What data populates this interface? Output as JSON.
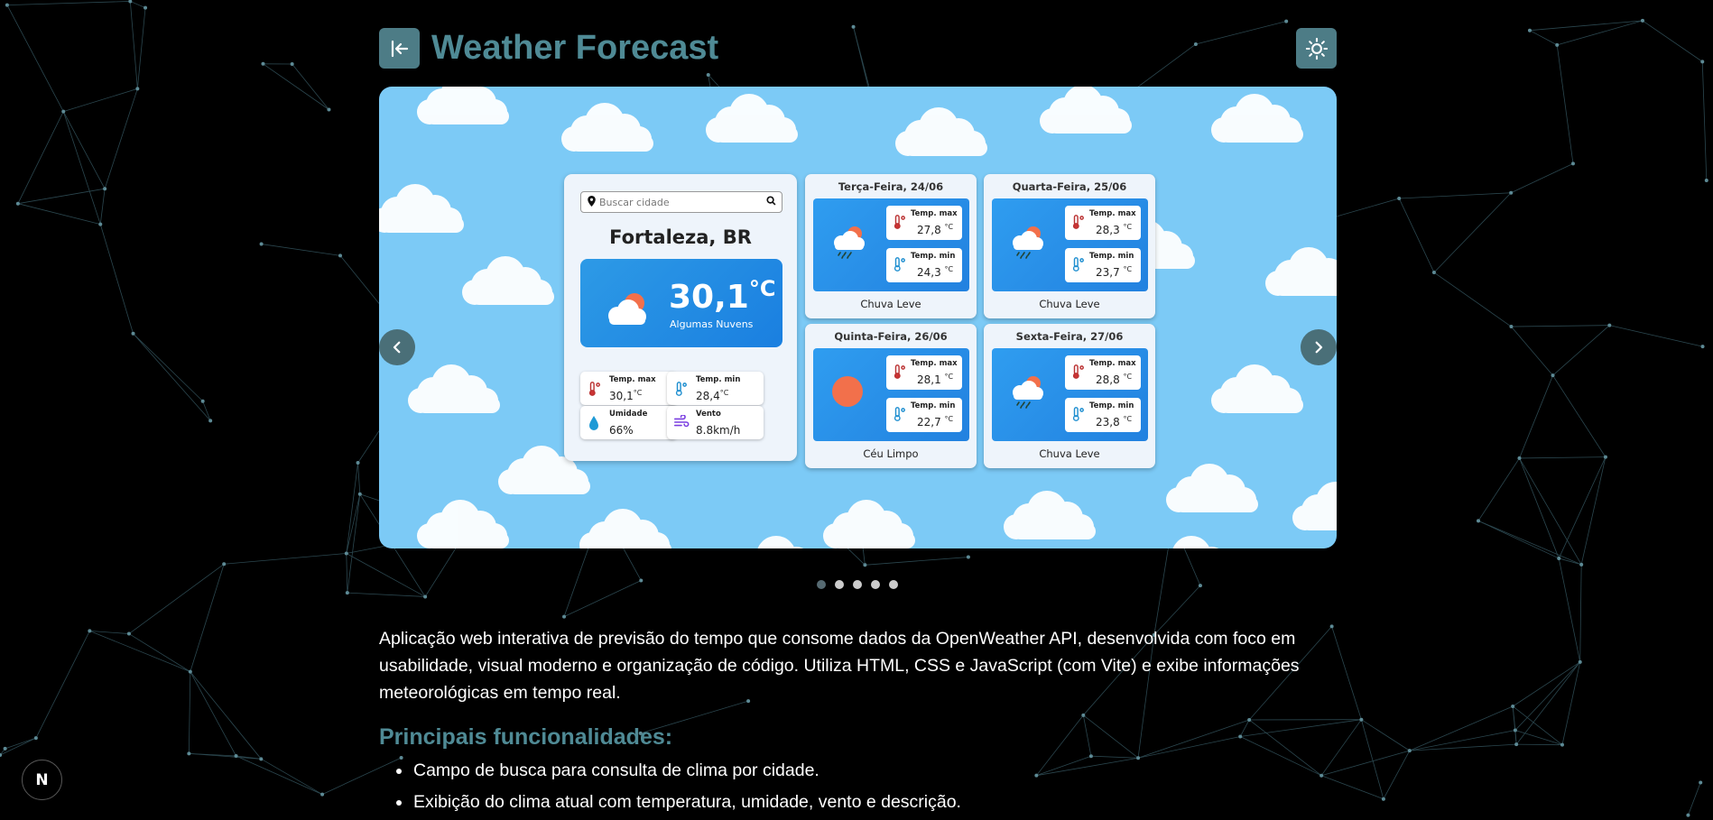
{
  "header": {
    "title": "Weather Forecast",
    "back_icon": "exit-arrow-icon",
    "theme_icon": "sun-icon"
  },
  "colors": {
    "accent": "#4f8a95",
    "button_bg": "#4d7c86",
    "sky": "#7ccaf6",
    "card_blue": "#2089e3",
    "background": "#000000"
  },
  "carousel": {
    "prev_icon": "chevron-left-icon",
    "next_icon": "chevron-right-icon",
    "slide_count": 5,
    "active_index": 0
  },
  "app_preview": {
    "search_placeholder": "Buscar cidade",
    "city": "Fortaleza, BR",
    "current_temp": "30,1",
    "current_unit": "°C",
    "current_desc": "Algumas Nuvens",
    "stats": [
      {
        "label": "Temp. max",
        "value": "30,1",
        "unit": "°C",
        "icon": "thermometer-hot-icon"
      },
      {
        "label": "Temp. min",
        "value": "28,4",
        "unit": "°C",
        "icon": "thermometer-cold-icon"
      },
      {
        "label": "Umidade",
        "value": "66%",
        "unit": "",
        "icon": "water-drop-icon"
      },
      {
        "label": "Vento",
        "value": "8.8km/h",
        "unit": "",
        "icon": "wind-icon"
      }
    ],
    "forecast": [
      {
        "day": "Terça-Feira, 24/06",
        "max": "27,8",
        "min": "24,3",
        "unit": "°C",
        "max_label": "Temp. max",
        "min_label": "Temp. min",
        "desc": "Chuva Leve",
        "icon": "rain-cloud-icon"
      },
      {
        "day": "Quarta-Feira, 25/06",
        "max": "28,3",
        "min": "23,7",
        "unit": "°C",
        "max_label": "Temp. max",
        "min_label": "Temp. min",
        "desc": "Chuva Leve",
        "icon": "rain-cloud-icon"
      },
      {
        "day": "Quinta-Feira, 26/06",
        "max": "28,1",
        "min": "22,7",
        "unit": "°C",
        "max_label": "Temp. max",
        "min_label": "Temp. min",
        "desc": "Céu Limpo",
        "icon": "sun-icon"
      },
      {
        "day": "Sexta-Feira, 27/06",
        "max": "28,8",
        "min": "23,8",
        "unit": "°C",
        "max_label": "Temp. max",
        "min_label": "Temp. min",
        "desc": "Chuva Leve",
        "icon": "rain-cloud-icon"
      }
    ]
  },
  "description": "Aplicação web interativa de previsão do tempo que consome dados da OpenWeather API, desenvolvida com foco em usabilidade, visual moderno e organização de código. Utiliza HTML, CSS e JavaScript (com Vite) e exibe informações meteorológicas em tempo real.",
  "features": {
    "title": "Principais funcionalidades:",
    "items": [
      "Campo de busca para consulta de clima por cidade.",
      "Exibição do clima atual com temperatura, umidade, vento e descrição."
    ]
  },
  "badge": {
    "label": "N"
  }
}
